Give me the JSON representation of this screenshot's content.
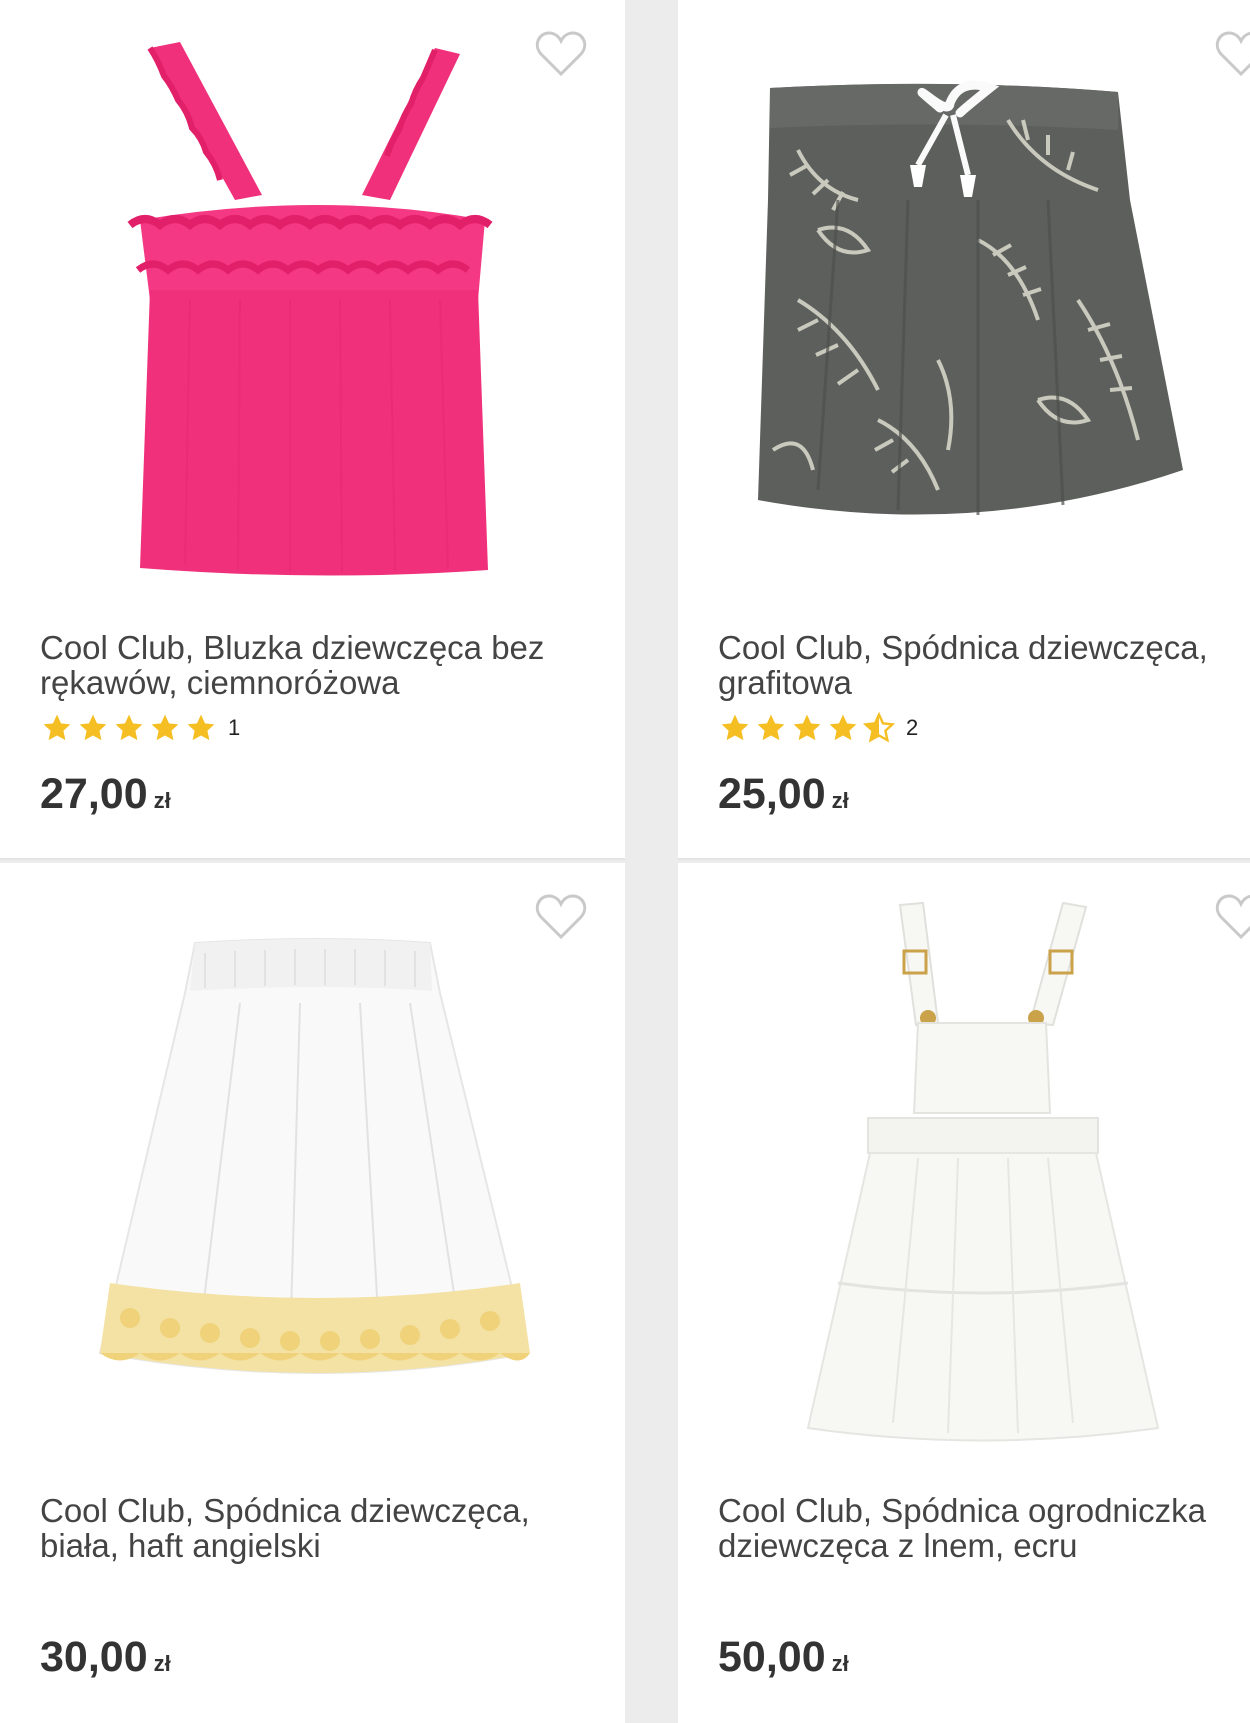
{
  "products": [
    {
      "title": "Cool Club, Bluzka dziewczęca bez rękawów, ciemnoróżowa",
      "rating": 5,
      "rating_count": "1",
      "price": "27,00",
      "currency": "zł",
      "image_color": "#f0307a"
    },
    {
      "title": "Cool Club, Spódnica dziewczęca, grafitowa",
      "rating": 4.5,
      "rating_count": "2",
      "price": "25,00",
      "currency": "zł",
      "image_color": "#5c5f5b"
    },
    {
      "title": "Cool Club, Spódnica dziewczęca, biała, haft angielski",
      "price": "30,00",
      "currency": "zł",
      "image_color": "#fafafa",
      "accent_color": "#efd27a"
    },
    {
      "title": "Cool Club, Spódnica ogrodniczka dziewczęca z lnem, ecru",
      "price": "50,00",
      "currency": "zł",
      "image_color": "#f7f7f4",
      "accent_color": "#c9a24a"
    }
  ],
  "icons": {
    "favorite": "heart-outline-icon",
    "rating": "star-icon"
  },
  "colors": {
    "star": "#f5be22",
    "heart": "#c9c9c9",
    "price": "#333333",
    "title": "#444444"
  }
}
